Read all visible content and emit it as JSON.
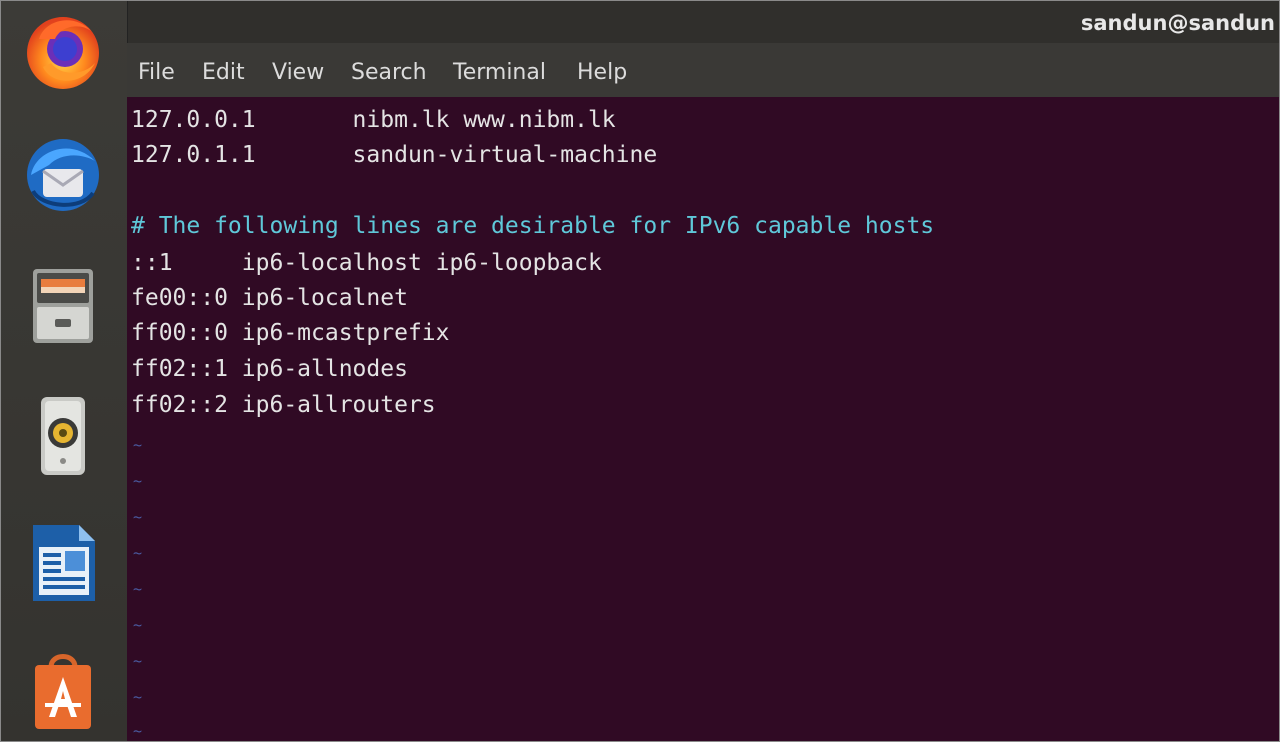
{
  "topbar": {
    "user": "sandun@sandun"
  },
  "dock": {
    "items": [
      {
        "name": "Firefox",
        "icon": "firefox-icon"
      },
      {
        "name": "Thunderbird",
        "icon": "thunderbird-icon"
      },
      {
        "name": "Files",
        "icon": "files-icon"
      },
      {
        "name": "Rhythmbox",
        "icon": "rhythmbox-icon"
      },
      {
        "name": "LibreOffice Writer",
        "icon": "writer-icon"
      },
      {
        "name": "Ubuntu Software",
        "icon": "software-icon"
      }
    ]
  },
  "menu": {
    "items": [
      "File",
      "Edit",
      "View",
      "Search",
      "Terminal",
      "Help"
    ]
  },
  "terminal": {
    "lines": [
      "127.0.0.1       nibm.lk www.nibm.lk",
      "127.0.1.1       sandun-virtual-machine",
      "",
      "# The following lines are desirable for IPv6 capable hosts",
      "::1     ip6-localhost ip6-loopback",
      "fe00::0 ip6-localnet",
      "ff00::0 ip6-mcastprefix",
      "ff02::1 ip6-allnodes",
      "ff02::2 ip6-allrouters"
    ],
    "tilde": "~",
    "colors": {
      "background": "#300a24",
      "text": "#e4e4e4",
      "comment": "#5fc8d9",
      "tilde": "#4a5aa0"
    }
  }
}
